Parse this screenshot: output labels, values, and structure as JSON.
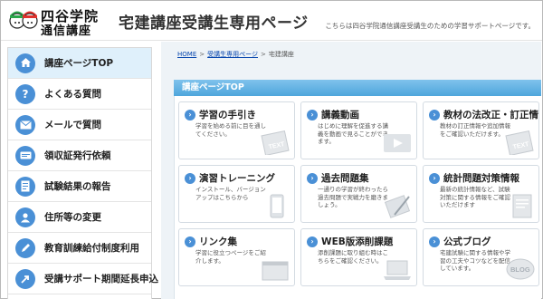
{
  "header": {
    "logo_line1": "四谷学院",
    "logo_line2": "通信講座",
    "site_title": "宅建講座受講生専用ページ",
    "tagline": "こちらは四谷学院通信講座受講生のための学習サポートページです。"
  },
  "sidebar": {
    "items": [
      {
        "label": "講座ページTOP",
        "icon": "home-icon",
        "active": true
      },
      {
        "label": "よくある質問",
        "icon": "question-icon",
        "active": false
      },
      {
        "label": "メールで質問",
        "icon": "mail-icon",
        "active": false
      },
      {
        "label": "領収証発行依頼",
        "icon": "receipt-icon",
        "active": false
      },
      {
        "label": "試験結果の報告",
        "icon": "report-icon",
        "active": false
      },
      {
        "label": "住所等の変更",
        "icon": "address-icon",
        "active": false
      },
      {
        "label": "教育訓練給付制度利用",
        "icon": "pencil-icon",
        "active": false
      },
      {
        "label": "受講サポート期間延長申込",
        "icon": "arrow-icon",
        "active": false
      }
    ]
  },
  "breadcrumb": {
    "home": "HOME",
    "student_page": "受講生専用ページ",
    "current": "宅建講座"
  },
  "main": {
    "section_title": "講座ページTOP",
    "cards": [
      {
        "title": "学習の手引き",
        "desc": "学習を始める前に目を通してください。",
        "art": "text-book-icon"
      },
      {
        "title": "講義動画",
        "desc": "はじめに理解を促進する講義を動画で見ることができます。",
        "art": "video-play-icon"
      },
      {
        "title": "教材の法改正・訂正情報",
        "desc": "教材の訂正情報や追加情報をご確認いただけます。",
        "art": "text-book-icon"
      },
      {
        "title": "演習トレーニング",
        "desc": "インストール、バージョンアップはこちらから",
        "art": "smartphone-icon"
      },
      {
        "title": "過去問題集",
        "desc": "一通りの学習が終わったら過去問題で実戦力を磨きましょう。",
        "art": "tablet-pen-icon"
      },
      {
        "title": "統計問題対策情報",
        "desc": "最新の統計情報など、試験対策に関する情報をご確認いただけます",
        "art": "document-icon"
      },
      {
        "title": "リンク集",
        "desc": "学習に役立つページをご紹介します。",
        "art": "window-icon"
      },
      {
        "title": "WEB版添削課題",
        "desc": "添削課題に取り組む時はこちらをご確認ください。",
        "art": "laptop-icon"
      },
      {
        "title": "公式ブログ",
        "desc": "宅建試験に関する情報や学習の工夫やコツなどを配信しています。",
        "art": "blog-icon"
      }
    ],
    "blog_badge": "BLOG",
    "text_badge": "TEXT"
  },
  "colors": {
    "accent": "#4a90d6",
    "section_head": "#5aaee0",
    "active_nav": "#dff0fb",
    "main_bg": "#eef3f7"
  }
}
